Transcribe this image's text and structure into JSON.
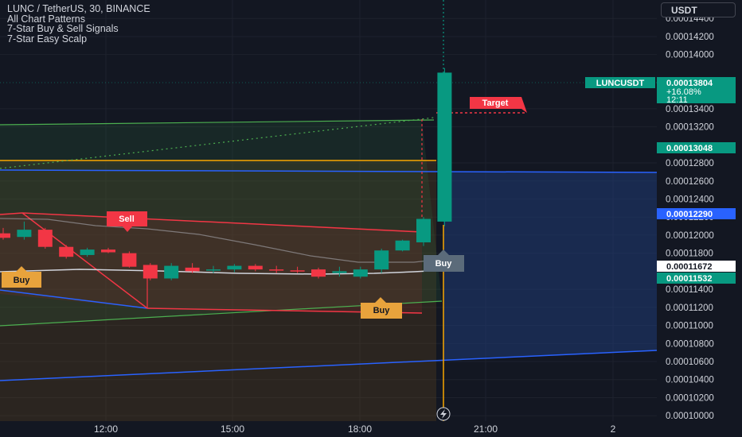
{
  "legend": {
    "symbol_line": "LUNC / TetherUS, 30, BINANCE",
    "indicator_1": "All Chart Patterns",
    "indicator_2": "7-Star Buy & Sell Signals",
    "indicator_3": "7-Star Easy Scalp"
  },
  "currency_button": "USDT",
  "colors": {
    "background": "#131722",
    "up": "#089981",
    "down": "#f23645",
    "target_red": "#f23645",
    "blue_line": "#2962ff",
    "orange_line": "#f7a600",
    "green_line": "#4caf50",
    "gray_label": "#5b6b7a",
    "buy_orange": "#e8a33c"
  },
  "price_tags": {
    "last_symbol": "LUNCUSDT",
    "last_price": "0.00013804",
    "last_change": "+16.08%",
    "last_countdown": "12:11",
    "green_upper": "0.00013048",
    "blue_level": "0.00012290",
    "white_level": "0.00011672",
    "green_lower": "0.00011532"
  },
  "signal_labels": {
    "target": "Target",
    "sell": "Sell",
    "buy_left": "Buy",
    "buy_mid": "Buy",
    "buy_right": "Buy"
  },
  "chart_data": {
    "type": "candlestick",
    "title": "LUNC / TetherUS, 30, BINANCE",
    "x_ticks": [
      "12:00",
      "15:00",
      "18:00",
      "21:00",
      "2"
    ],
    "y_ticks": [
      "0.00014400",
      "0.00014200",
      "0.00014000",
      "0.00013400",
      "0.00013200",
      "0.00012800",
      "0.00012600",
      "0.00012400",
      "0.00012200",
      "0.00012000",
      "0.00011800",
      "0.00011400",
      "0.00011200",
      "0.00011000",
      "0.00010800",
      "0.00010600",
      "0.00010400",
      "0.00010200",
      "0.00010000"
    ],
    "ylim": [
      9.94e-05,
      0.0001449
    ],
    "candles": [
      {
        "o": 0.0001202,
        "h": 0.0001208,
        "l": 0.0001195,
        "c": 0.0001197
      },
      {
        "o": 0.0001198,
        "h": 0.0001215,
        "l": 0.0001195,
        "c": 0.0001206
      },
      {
        "o": 0.0001206,
        "h": 0.0001208,
        "l": 0.0001185,
        "c": 0.0001187
      },
      {
        "o": 0.0001187,
        "h": 0.0001189,
        "l": 0.0001174,
        "c": 0.0001176
      },
      {
        "o": 0.0001178,
        "h": 0.0001186,
        "l": 0.0001176,
        "c": 0.0001184
      },
      {
        "o": 0.0001184,
        "h": 0.0001186,
        "l": 0.000118,
        "c": 0.0001181
      },
      {
        "o": 0.000118,
        "h": 0.0001182,
        "l": 0.0001164,
        "c": 0.0001165
      },
      {
        "o": 0.0001167,
        "h": 0.0001169,
        "l": 0.000115,
        "c": 0.0001152
      },
      {
        "o": 0.0001152,
        "h": 0.0001169,
        "l": 0.000115,
        "c": 0.0001166
      },
      {
        "o": 0.0001164,
        "h": 0.0001169,
        "l": 0.0001158,
        "c": 0.000116
      },
      {
        "o": 0.0001161,
        "h": 0.0001166,
        "l": 0.0001158,
        "c": 0.0001162
      },
      {
        "o": 0.0001162,
        "h": 0.0001168,
        "l": 0.0001159,
        "c": 0.0001166
      },
      {
        "o": 0.0001166,
        "h": 0.0001168,
        "l": 0.000116,
        "c": 0.0001162
      },
      {
        "o": 0.0001162,
        "h": 0.0001166,
        "l": 0.0001158,
        "c": 0.0001161
      },
      {
        "o": 0.0001161,
        "h": 0.0001165,
        "l": 0.0001158,
        "c": 0.000116
      },
      {
        "o": 0.0001162,
        "h": 0.0001164,
        "l": 0.0001152,
        "c": 0.0001154
      },
      {
        "o": 0.0001158,
        "h": 0.0001165,
        "l": 0.0001154,
        "c": 0.000116
      },
      {
        "o": 0.0001154,
        "h": 0.0001165,
        "l": 0.0001152,
        "c": 0.0001162
      },
      {
        "o": 0.0001162,
        "h": 0.0001185,
        "l": 0.0001158,
        "c": 0.0001183
      },
      {
        "o": 0.0001183,
        "h": 0.0001195,
        "l": 0.0001182,
        "c": 0.0001194
      },
      {
        "o": 0.0001192,
        "h": 0.000122,
        "l": 0.0001188,
        "c": 0.0001218
      },
      {
        "o": 0.0001215,
        "h": 0.0001385,
        "l": 0.000121,
        "c": 0.000138
      }
    ]
  }
}
